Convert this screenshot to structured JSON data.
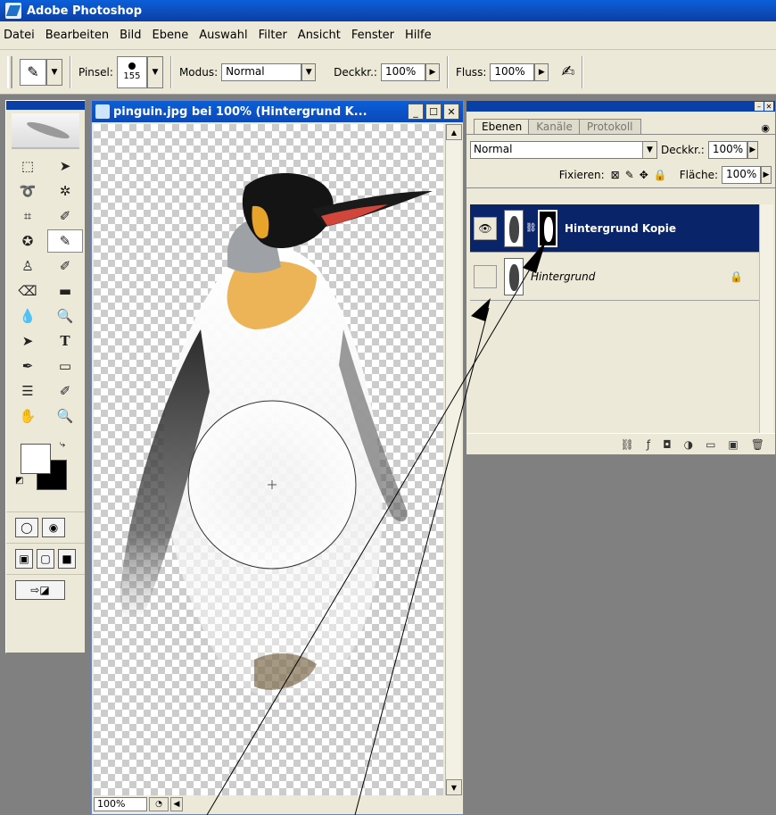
{
  "app": {
    "title": "Adobe Photoshop"
  },
  "menu": [
    "Datei",
    "Bearbeiten",
    "Bild",
    "Ebene",
    "Auswahl",
    "Filter",
    "Ansicht",
    "Fenster",
    "Hilfe"
  ],
  "options": {
    "brush_label": "Pinsel:",
    "brush_size": "155",
    "mode_label": "Modus:",
    "mode_value": "Normal",
    "opacity_label": "Deckkr.:",
    "opacity_value": "100%",
    "flow_label": "Fluss:",
    "flow_value": "100%"
  },
  "document": {
    "title": "pinguin.jpg bei 100% (Hintergrund K...",
    "zoom": "100%"
  },
  "layers_palette": {
    "tabs": [
      "Ebenen",
      "Kanäle",
      "Protokoll"
    ],
    "blend_mode": "Normal",
    "opacity_label": "Deckkr.:",
    "opacity_value": "100%",
    "lock_label": "Fixieren:",
    "fill_label": "Fläche:",
    "fill_value": "100%",
    "layers": [
      {
        "name": "Hintergrund Kopie",
        "visible": true,
        "selected": true,
        "has_mask": true
      },
      {
        "name": "Hintergrund",
        "visible": false,
        "selected": false,
        "locked": true
      }
    ]
  },
  "colors": {
    "title_blue": "#0a3fa8",
    "selection_blue": "#0a246a",
    "foreground": "#ffffff",
    "background": "#000000"
  },
  "icons": [
    "brush-icon",
    "move-icon",
    "marquee-icon",
    "lasso-icon",
    "magic-wand-icon",
    "crop-icon",
    "eye-icon",
    "lock-icon",
    "trash-icon"
  ]
}
